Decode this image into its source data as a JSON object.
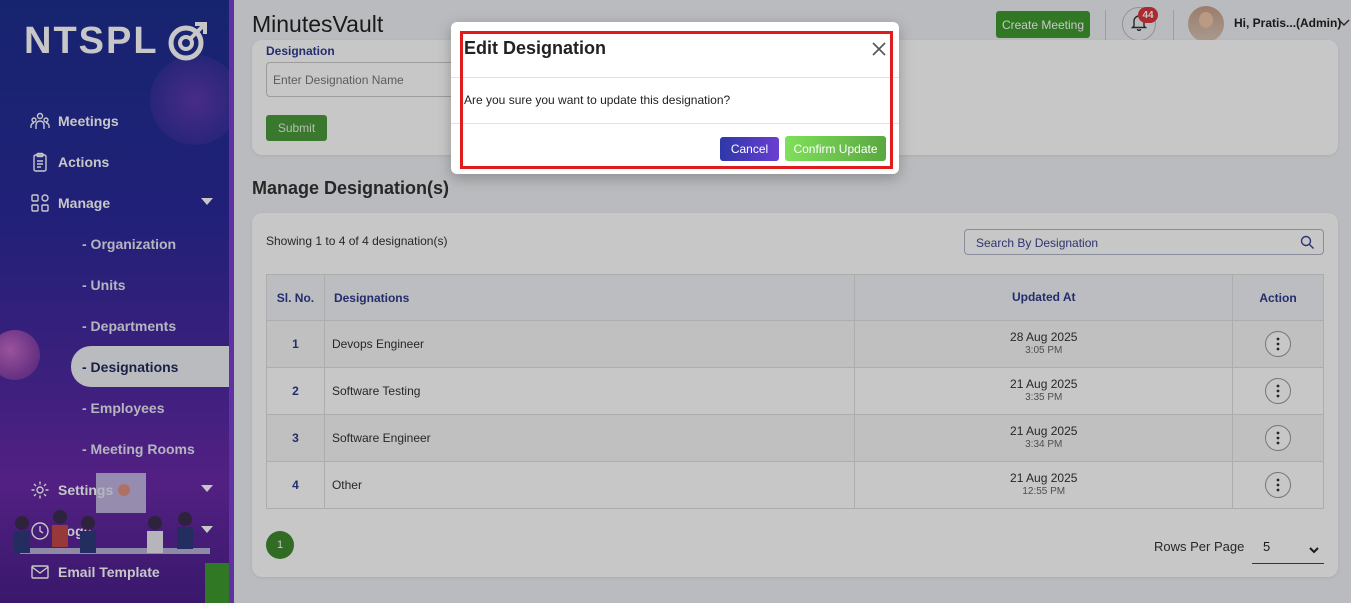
{
  "brand": {
    "logo_text": "NTSPL"
  },
  "header": {
    "app_title": "MinutesVault",
    "create_meeting_label": "Create Meeting",
    "notification_count": "44",
    "user_greeting": "Hi, Pratis...(Admin)"
  },
  "sidebar": {
    "items": [
      {
        "label": "Meetings",
        "icon": "meetings-icon"
      },
      {
        "label": "Actions",
        "icon": "clipboard-icon"
      },
      {
        "label": "Manage",
        "icon": "grid-icon"
      },
      {
        "label": "- Organization"
      },
      {
        "label": "- Units"
      },
      {
        "label": "- Departments"
      },
      {
        "label": "- Designations",
        "active": true
      },
      {
        "label": "- Employees"
      },
      {
        "label": "- Meeting Rooms"
      },
      {
        "label": "Settings",
        "icon": "gear-icon"
      },
      {
        "label": "Logs",
        "icon": "history-icon"
      },
      {
        "label": "Email Template",
        "icon": "mail-icon"
      }
    ]
  },
  "form": {
    "label": "Designation",
    "input_placeholder": "Enter Designation Name",
    "submit_label": "Submit"
  },
  "list": {
    "section_title": "Manage Designation(s)",
    "showing_text": "Showing 1 to 4 of 4 designation(s)",
    "search_placeholder": "Search By Designation",
    "columns": [
      "Sl. No.",
      "Designations",
      "Updated At",
      "Action"
    ],
    "rows": [
      {
        "sl": "1",
        "name": "Devops Engineer",
        "date": "28 Aug 2025",
        "time": "3:05 PM"
      },
      {
        "sl": "2",
        "name": "Software Testing",
        "date": "21 Aug 2025",
        "time": "3:35 PM"
      },
      {
        "sl": "3",
        "name": "Software Engineer",
        "date": "21 Aug 2025",
        "time": "3:34 PM"
      },
      {
        "sl": "4",
        "name": "Other",
        "date": "21 Aug 2025",
        "time": "12:55 PM"
      }
    ],
    "current_page": "1",
    "rows_per_page_label": "Rows Per Page",
    "rows_per_page_value": "5"
  },
  "modal": {
    "title": "Edit Designation",
    "message": "Are you sure you want to update this designation?",
    "cancel_label": "Cancel",
    "confirm_label": "Confirm Update"
  },
  "colors": {
    "accent_green": "#3f9a2f",
    "accent_navy": "#2e3a8c",
    "highlight_red": "#e01c1c"
  }
}
